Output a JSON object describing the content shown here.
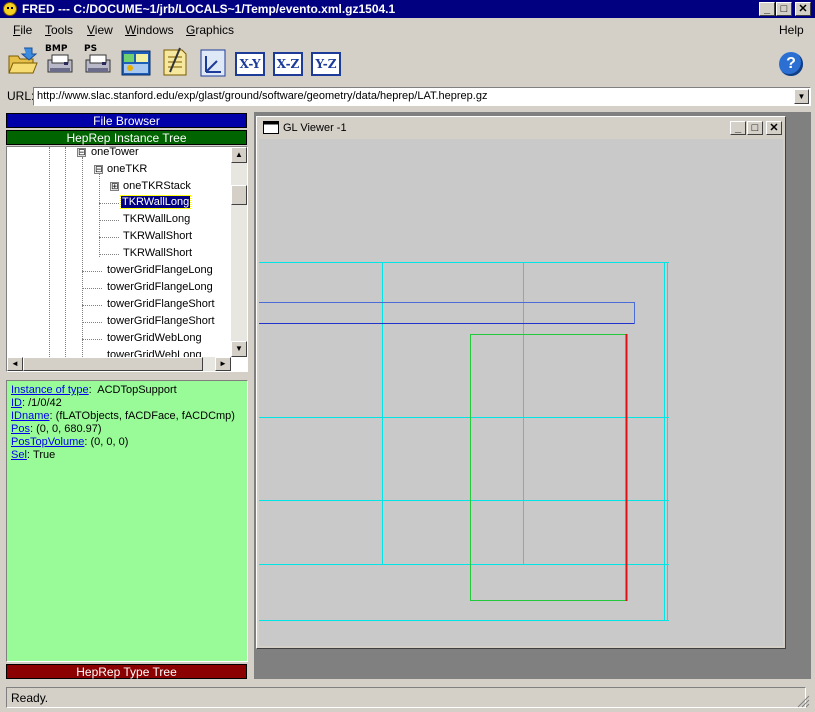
{
  "app": {
    "title": "FRED --- C:/DOCUME~1/jrb/LOCALS~1/Temp/evento.xml.gz1504.1"
  },
  "window_buttons": {
    "minimize": "_",
    "maximize": "□",
    "close": "✕"
  },
  "menu": {
    "file": "File",
    "tools": "Tools",
    "view": "View",
    "windows": "Windows",
    "graphics": "Graphics",
    "help": "Help"
  },
  "toolbar": {
    "bmp_label": "BMP",
    "ps_label": "PS",
    "xy_label": "X-Y",
    "xz_label": "X-Z",
    "yz_label": "Y-Z",
    "help_label": "?"
  },
  "url": {
    "label": "URL:",
    "value": "http://www.slac.stanford.edu/exp/glast/ground/software/geometry/data/heprep/LAT.heprep.gz",
    "drop": "▼"
  },
  "panels": {
    "file_browser": "File Browser",
    "instance_tree": "HepRep Instance Tree",
    "type_tree": "HepRep Type Tree"
  },
  "tree": {
    "items": [
      {
        "label": "oneTower",
        "expander": "⊟"
      },
      {
        "label": "oneTKR",
        "expander": "⊟"
      },
      {
        "label": "oneTKRStack",
        "expander": "⊞"
      },
      {
        "label": "TKRWallLong"
      },
      {
        "label": "TKRWallLong"
      },
      {
        "label": "TKRWallShort"
      },
      {
        "label": "TKRWallShort"
      },
      {
        "label": "towerGridFlangeLong"
      },
      {
        "label": "towerGridFlangeLong"
      },
      {
        "label": "towerGridFlangeShort"
      },
      {
        "label": "towerGridFlangeShort"
      },
      {
        "label": "towerGridWebLong"
      },
      {
        "label": "towerGridWebLong"
      }
    ],
    "selected_index": 3,
    "scroll_up": "▲",
    "scroll_down": "▼",
    "scroll_left": "◄",
    "scroll_right": "►"
  },
  "properties": [
    {
      "key": "Instance of type",
      "value": "ACDTopSupport"
    },
    {
      "key": "ID",
      "value": "/1/0/42"
    },
    {
      "key": "IDname",
      "value": "(fLATObjects, fACDFace, fACDCmp)"
    },
    {
      "key": "Pos",
      "value": "(0, 0, 680.97)"
    },
    {
      "key": "PosTopVolume",
      "value": "(0, 0, 0)"
    },
    {
      "key": "Sel",
      "value": "True"
    }
  ],
  "viewer": {
    "title": "GL Viewer -1",
    "colors": {
      "cyan": "#00e5e5",
      "blue": "#2233cc",
      "green": "#22c93a",
      "red": "#dd1111",
      "background": "#c9c9c9"
    }
  },
  "status": {
    "text": "Ready."
  }
}
